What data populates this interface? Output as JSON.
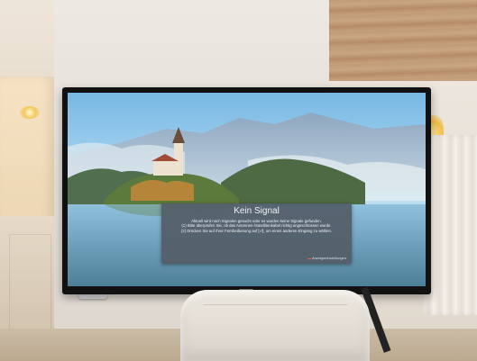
{
  "tv_dialog": {
    "title": "Kein Signal",
    "line1": "Aktuell wird nach Signalen gesucht oder es wurden keine Signale gefunden.",
    "line2": "(1) Bitte überprüfen Sie, ob das Antennen-/Satellitenkabel richtig angeschlossen wurde.",
    "line3": "(2) Drücken Sie auf Ihrer Fernbedienung auf [⏎], um einen anderen Eingang zu wählen.",
    "footer": "Anzeigeeinstellungen"
  },
  "colors": {
    "dialog_bg": "#5b6670",
    "sky": "#78b8e3",
    "lake": "#5f8fa8",
    "tv_frame": "#111111"
  }
}
